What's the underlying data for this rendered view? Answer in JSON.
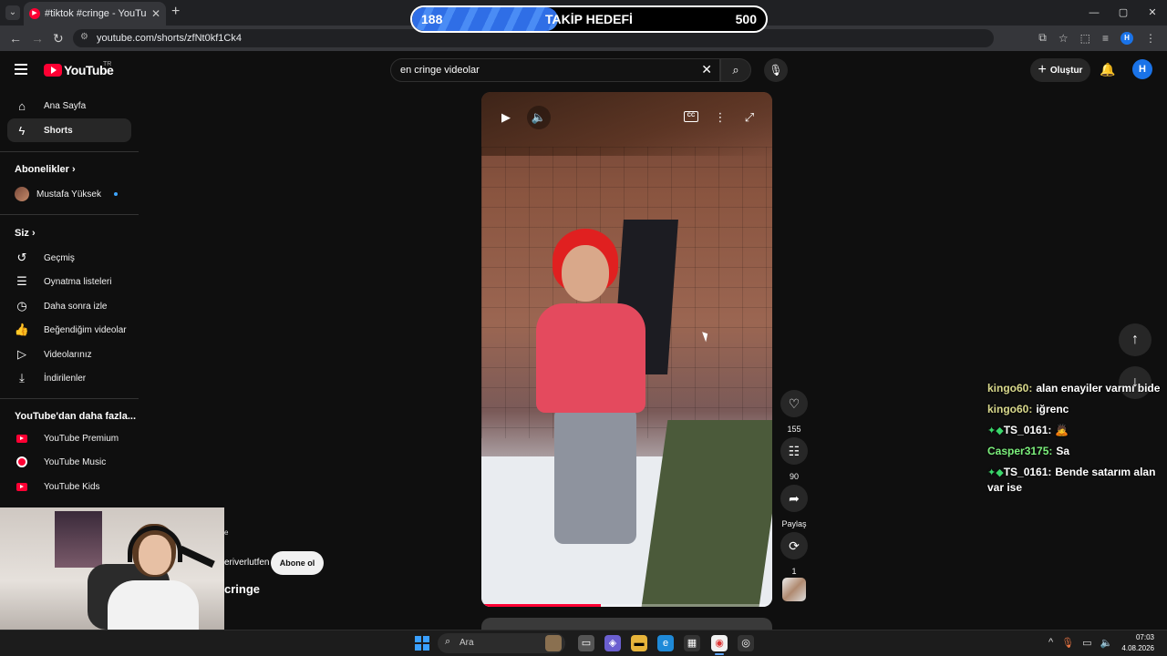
{
  "browser": {
    "tab_title": "#tiktok #cringe - YouTube",
    "tab_favicon": "youtube-icon",
    "url": "youtube.com/shorts/zfNt0kf1Ck4",
    "window_controls": [
      "minimize",
      "maximize",
      "close"
    ],
    "profile_initial": "H"
  },
  "overlay_goal": {
    "current": "188",
    "label": "TAKİP HEDEFİ",
    "target": "500",
    "progress_fraction": 0.376
  },
  "youtube": {
    "logo_text": "YouTube",
    "country_code": "TR",
    "search_query": "en cringe videolar",
    "create_label": "Oluştur",
    "avatar_initial": "H",
    "brand_color": "#ff0033"
  },
  "sidebar": {
    "main": [
      {
        "label": "Ana Sayfa",
        "icon": "home-icon"
      },
      {
        "label": "Shorts",
        "icon": "shorts-icon",
        "active": true
      }
    ],
    "subscriptions_header": "Abonelikler",
    "subscriptions": [
      {
        "label": "Mustafa Yüksek",
        "has_new": true
      }
    ],
    "you_header": "Siz",
    "you": [
      {
        "label": "Geçmiş",
        "icon": "history-icon"
      },
      {
        "label": "Oynatma listeleri",
        "icon": "playlist-icon"
      },
      {
        "label": "Daha sonra izle",
        "icon": "clock-icon"
      },
      {
        "label": "Beğendiğim videolar",
        "icon": "thumbs-up-icon"
      },
      {
        "label": "Videolarınız",
        "icon": "video-icon"
      },
      {
        "label": "İndirilenler",
        "icon": "download-icon"
      }
    ],
    "more_header": "YouTube'dan daha fazla...",
    "more": [
      {
        "label": "YouTube Premium"
      },
      {
        "label": "YouTube Music"
      },
      {
        "label": "YouTube Kids"
      }
    ]
  },
  "short": {
    "progress_fraction": 0.41,
    "likes": "155",
    "comments": "90",
    "share_label": "Paylaş",
    "remix_count": "1",
    "channel_fragment": "eriverlutfen",
    "subscribe_label": "Abone ol",
    "title_fragment": "cringe",
    "small_fragment": "e"
  },
  "chat": [
    {
      "user": "kingo60:",
      "user_color": "#d9d98c",
      "message": "alan enayiler varmı bide",
      "badges": ""
    },
    {
      "user": "kingo60:",
      "user_color": "#d9d98c",
      "message": "iğrenc",
      "badges": ""
    },
    {
      "user": "TS_0161:",
      "user_color": "#ffffff",
      "message": "🙇",
      "badges": "✦◆"
    },
    {
      "user": "Casper3175:",
      "user_color": "#7cf07c",
      "message": "Sa",
      "badges": ""
    },
    {
      "user": "TS_0161:",
      "user_color": "#ffffff",
      "message": "Bende satarım alan var ise",
      "badges": "✦◆"
    }
  ],
  "taskbar": {
    "search_placeholder": "Ara",
    "time": "07:03",
    "date": "4.08.2026"
  }
}
